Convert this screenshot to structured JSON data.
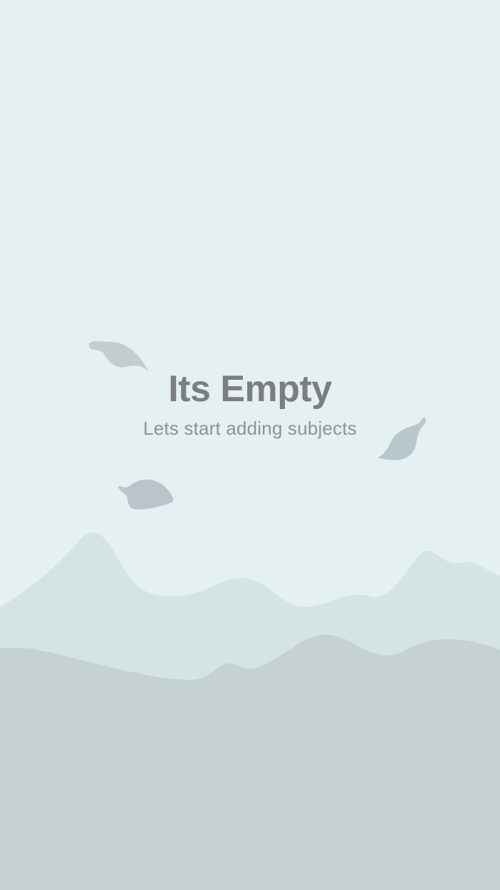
{
  "empty_state": {
    "title": "Its Empty",
    "subtitle": "Lets start adding subjects"
  },
  "colors": {
    "background": "#e4f0f2",
    "back_hills": "#d6e3e5",
    "front_hills": "#c5d1d3",
    "leaves": "#b9c5c8",
    "title": "#7b7e80",
    "subtitle": "#8e9294"
  },
  "illustration": {
    "icons": [
      "leaf-icon",
      "leaf-icon",
      "leaf-icon",
      "mountain-silhouette"
    ]
  }
}
